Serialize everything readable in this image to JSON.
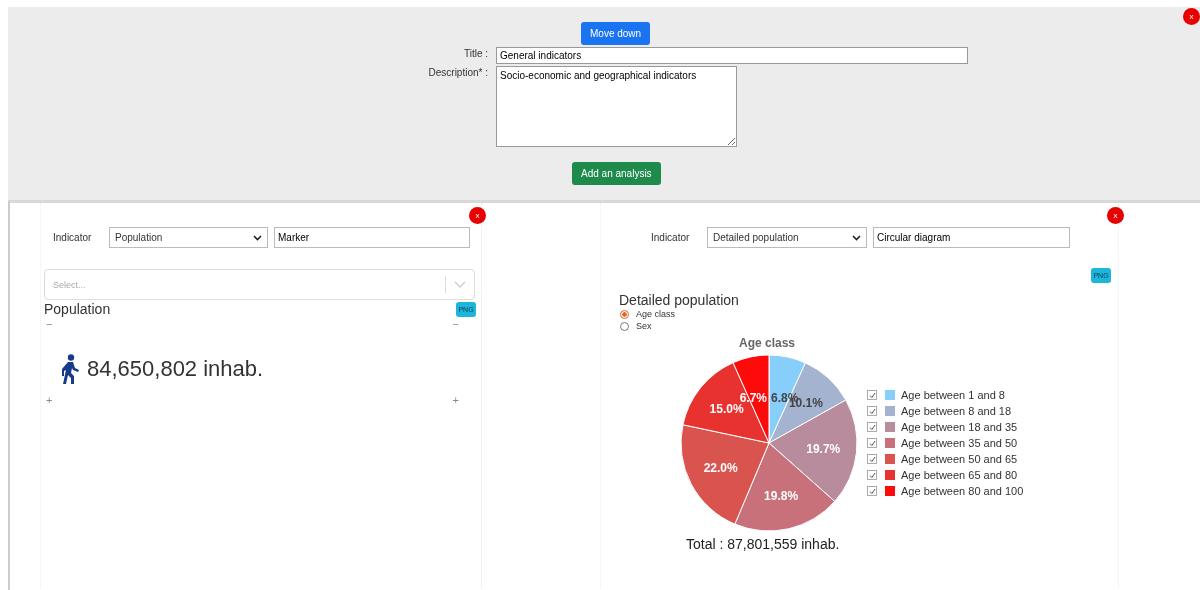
{
  "top_section": {
    "move_button": "Move down",
    "fields": [
      {
        "label": "Title :",
        "kind": "line",
        "value": "General indicators"
      },
      {
        "label": "Description* :",
        "kind": "multiline",
        "value": "Socio-economic and geographical indicators"
      }
    ],
    "add_button": "Add an analysis",
    "close": "x"
  },
  "panels": [
    {
      "kind": "marker",
      "close": "x",
      "indicator_label": "Indicator",
      "indicator": "Population",
      "type_value": "Marker",
      "select_placeholder": "Select...",
      "title": "Population",
      "export": "PNG",
      "zoom_out": [
        "−",
        "−"
      ],
      "zoom_in": [
        "+",
        "+"
      ],
      "figure": "84,650,802 inhab."
    },
    {
      "kind": "pie",
      "close": "x",
      "indicator_label": "Indicator",
      "indicator": "Detailed population",
      "type_value": "Circular diagram",
      "export": "PNG",
      "title": "Detailed population",
      "options": [
        {
          "label": "Age class",
          "selected": true
        },
        {
          "label": "Sex",
          "selected": false
        }
      ],
      "chart_data": {
        "type": "pie",
        "title": "Age class",
        "categories": [
          "Age between 1 and 8",
          "Age between 8 and 18",
          "Age between 18 and 35",
          "Age between 35 and 50",
          "Age between 50 and 65",
          "Age between 65 and 80",
          "Age between 80 and 100"
        ],
        "colors": [
          "#87cefa",
          "#a4b3cf",
          "#b88c9c",
          "#c9717a",
          "#d9534f",
          "#e8322f",
          "#ff0a0a"
        ],
        "values": [
          6.8,
          10.1,
          19.7,
          19.8,
          22.0,
          15.0,
          6.7
        ],
        "legend": "right",
        "value_labels": [
          "6.8%",
          "10.1%",
          "19.7%",
          "19.8%",
          "22.0%",
          "15.0%",
          "6.7%"
        ]
      },
      "legend_checked": [
        true,
        true,
        true,
        true,
        true,
        true,
        true
      ],
      "total": "Total : 87,801,559 inhab."
    }
  ]
}
